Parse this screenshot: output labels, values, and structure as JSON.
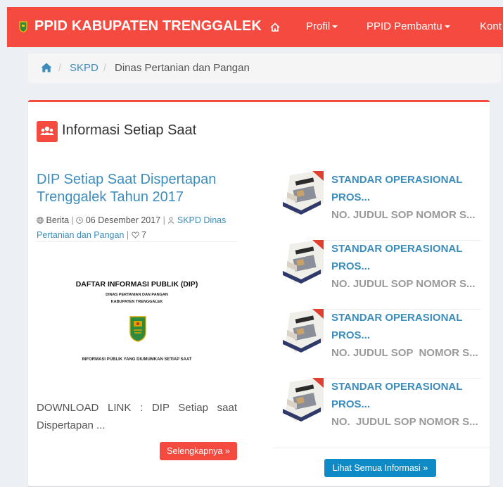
{
  "navbar": {
    "brand": "PPID KABUPATEN TRENGGALEK",
    "items": [
      {
        "label": "",
        "icon": "home-icon"
      },
      {
        "label": "Profil",
        "icon": "caret-down-icon"
      },
      {
        "label": "PPID Pembantu",
        "icon": "caret-down-icon"
      },
      {
        "label": "Kont"
      }
    ],
    "color": "#f44a3f"
  },
  "breadcrumb": {
    "items": [
      "SKPD",
      "Dinas Pertanian dan Pangan"
    ],
    "separator": "/"
  },
  "panel": {
    "title": "Informasi Setiap Saat",
    "icon": "users-icon"
  },
  "featured": {
    "title": "DIP Setiap Saat Dispertapan Trenggalek Tahun 2017",
    "category": "Berita",
    "date": "06 Desember 2017",
    "author": "SKPD Dinas Pertanian dan Pangan",
    "likes": "7",
    "image": {
      "heading": "DAFTAR INFORMASI PUBLIK (DIP)",
      "line1": "DINAS PERTANIAN DAN PANGAN",
      "line2": "KABUPATEN TRENGGALEK",
      "footer": "INFORMASI PUBLIK YANG DIUMUMKAN SETIAP SAAT"
    },
    "excerpt": "DOWNLOAD LINK : DIP Setiap saat Dispertapan ...",
    "button": "Selengkapnya »"
  },
  "items": [
    {
      "title": "STANDAR OPERASIONAL PROS...",
      "desc": "NO. JUDUL SOP NOMOR S..."
    },
    {
      "title": "STANDAR OPERASIONAL PROS...",
      "desc": "NO. JUDUL SOP NOMOR S..."
    },
    {
      "title": "STANDAR OPERASIONAL PROS...",
      "desc": "NO. JUDUL SOP  NOMOR S..."
    },
    {
      "title": "STANDAR OPERASIONAL PROS...",
      "desc": "NO.  JUDUL SOP NOMOR S..."
    }
  ],
  "all_button": "Lihat Semua Informasi »",
  "colors": {
    "accent": "#f44a3f",
    "link": "#3c8dbc",
    "primary_button": "#0e8bc6"
  }
}
